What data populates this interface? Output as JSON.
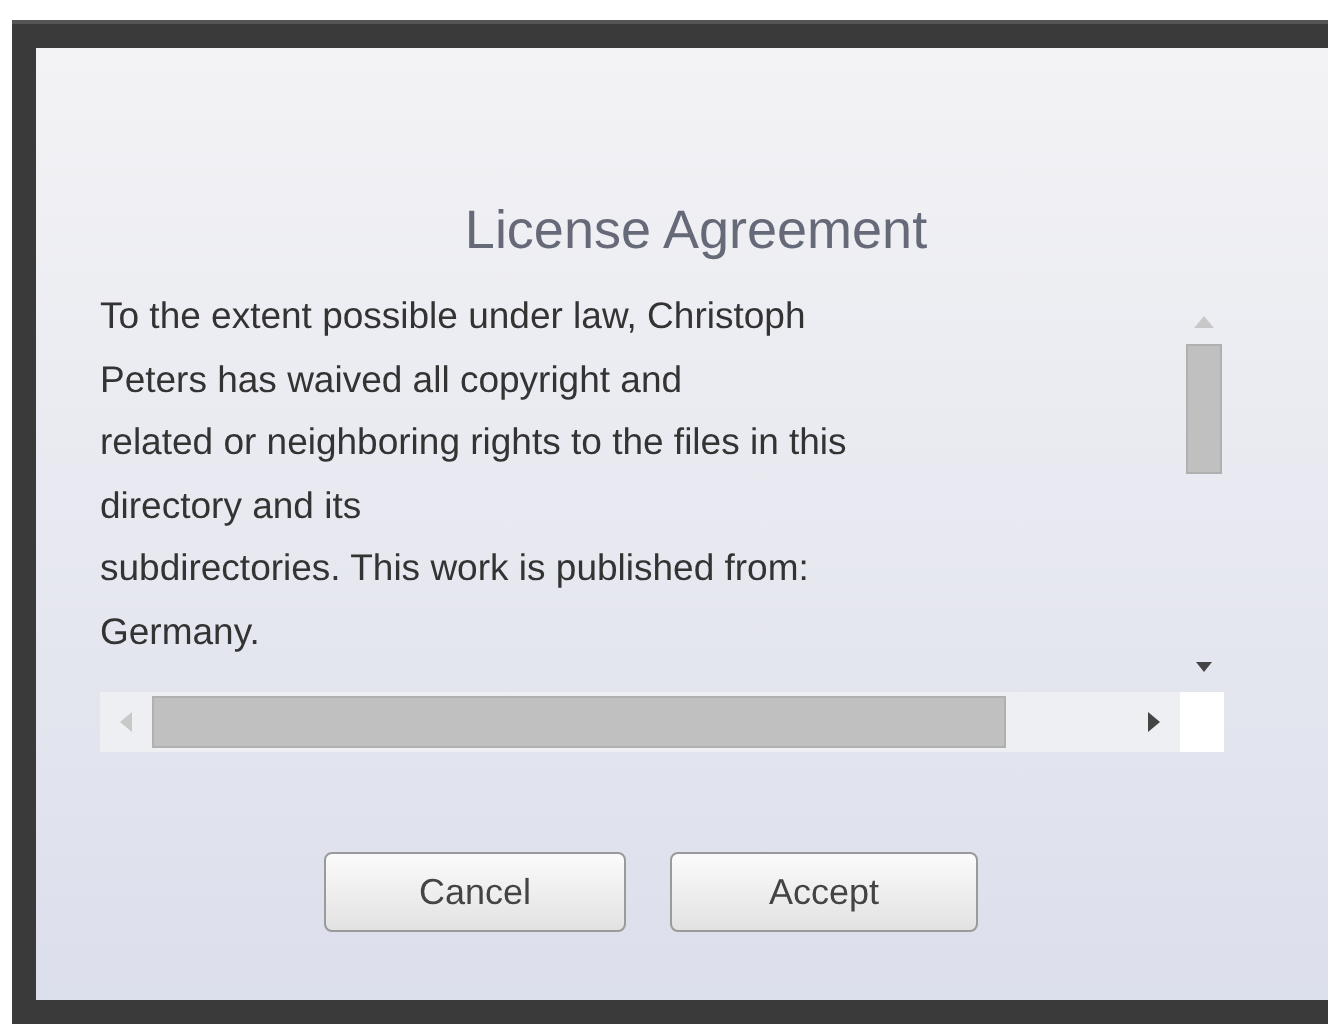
{
  "dialog": {
    "title": "License Agreement",
    "text": "To the extent possible under law, Christoph\nPeters has waived all copyright and\nrelated or neighboring rights to the files in this\ndirectory and its\nsubdirectories. This work is published from:\nGermany.",
    "buttons": [
      {
        "label": "Cancel"
      },
      {
        "label": "Accept"
      }
    ]
  }
}
